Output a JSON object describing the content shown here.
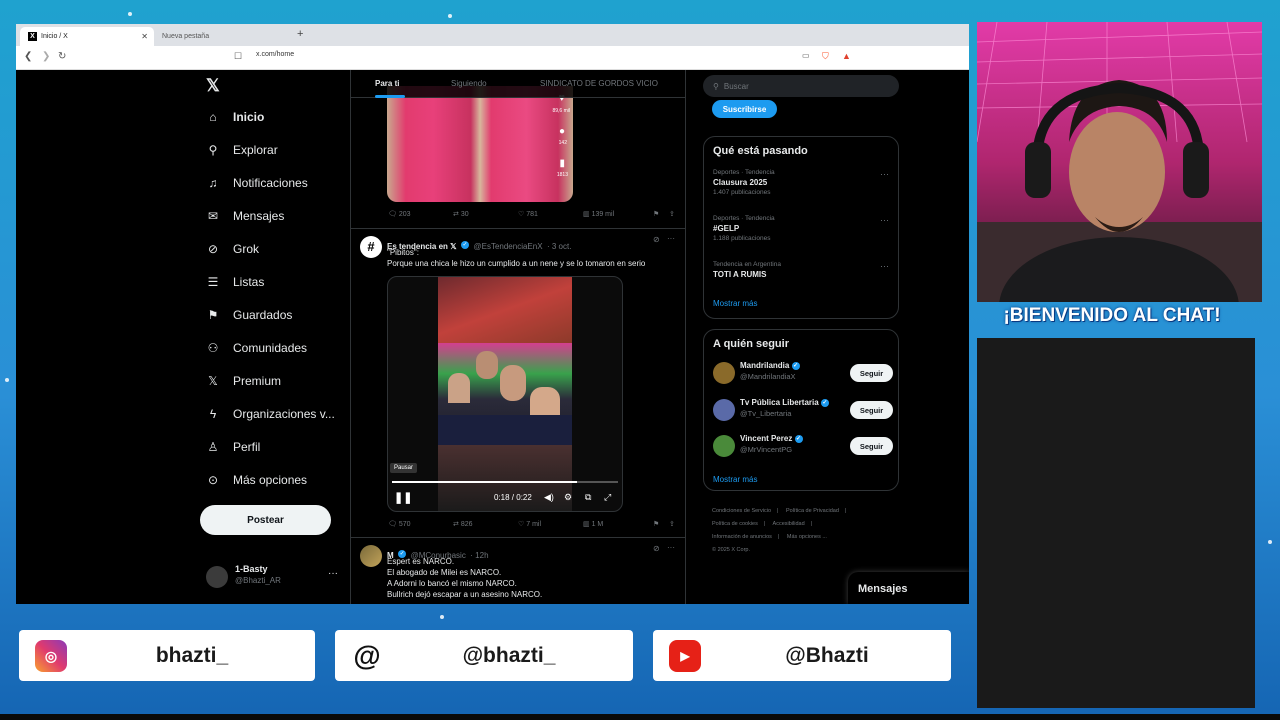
{
  "browser": {
    "tabs": [
      {
        "label": "Inicio / X"
      },
      {
        "label": "Nueva pestaña"
      }
    ],
    "url": "x.com/home"
  },
  "nav": {
    "items": [
      {
        "label": "Inicio",
        "icon": "home-icon"
      },
      {
        "label": "Explorar",
        "icon": "search-icon"
      },
      {
        "label": "Notificaciones",
        "icon": "bell-icon"
      },
      {
        "label": "Mensajes",
        "icon": "mail-icon"
      },
      {
        "label": "Grok",
        "icon": "grok-icon"
      },
      {
        "label": "Listas",
        "icon": "list-icon"
      },
      {
        "label": "Guardados",
        "icon": "bookmark-icon"
      },
      {
        "label": "Comunidades",
        "icon": "people-icon"
      },
      {
        "label": "Premium",
        "icon": "x-icon"
      },
      {
        "label": "Organizaciones v...",
        "icon": "lightning-icon"
      },
      {
        "label": "Perfil",
        "icon": "person-icon"
      },
      {
        "label": "Más opciones",
        "icon": "more-circle-icon"
      }
    ],
    "post_label": "Postear",
    "profile": {
      "name": "1-Basty",
      "handle": "@Bhazti_AR"
    }
  },
  "feed": {
    "tabs": [
      "Para ti",
      "Siguiendo",
      "SINDICATO DE GORDOS VICIO"
    ],
    "post1": {
      "overlay_counts": [
        "89,6 mil",
        "142",
        "1813"
      ],
      "actions": {
        "replies": "203",
        "reposts": "30",
        "likes": "781",
        "views": "139 mil"
      }
    },
    "post2": {
      "name": "Es tendencia en 𝕏",
      "handle": "@EsTendenciaEnX",
      "time": "· 3 oct.",
      "text_line1": "\"Pibitos\":",
      "text_line2": "Porque una chica le hizo un cumplido a un nene y se lo tomaron en serio",
      "video": {
        "tooltip": "Pausar",
        "time": "0:18 / 0:22",
        "progress": 0.82
      },
      "actions": {
        "replies": "570",
        "reposts": "826",
        "likes": "7 mil",
        "views": "1 M"
      }
    },
    "post3": {
      "name": "M",
      "handle": "@MConurbasic",
      "time": "· 12h",
      "lines": [
        "Espert es NARCO.",
        "El abogado de Milei es NARCO.",
        "A Adorni lo bancó el mismo NARCO.",
        "Bullrich dejó escapar a un asesino NARCO."
      ]
    }
  },
  "right": {
    "search_placeholder": "Buscar",
    "subscribe_label": "Suscribirse",
    "trending": {
      "title": "Qué está pasando",
      "items": [
        {
          "category": "Deportes · Tendencia",
          "name": "Clausura 2025",
          "count": "1.407 publicaciones"
        },
        {
          "category": "Deportes · Tendencia",
          "name": "#GELP",
          "count": "1.188 publicaciones"
        },
        {
          "category": "Tendencia en Argentina",
          "name": "TOTI A RUMIS",
          "count": ""
        }
      ],
      "show_more": "Mostrar más"
    },
    "who_to_follow": {
      "title": "A quién seguir",
      "items": [
        {
          "name": "Mandrilandia",
          "handle": "@MandrilandiaX",
          "button": "Seguir"
        },
        {
          "name": "Tv Pública Libertaria",
          "handle": "@Tv_Libertaria",
          "button": "Seguir"
        },
        {
          "name": "Vincent Perez",
          "handle": "@MrVincentPG",
          "button": "Seguir"
        }
      ],
      "show_more": "Mostrar más"
    },
    "footer": {
      "links": [
        "Condiciones de Servicio",
        "Política de Privacidad",
        "Política de cookies",
        "Accesibilidad",
        "Información de anuncios",
        "Más opciones ..."
      ],
      "copyright": "© 2025 X Corp."
    },
    "messages_label": "Mensajes"
  },
  "overlay": {
    "welcome": "¡BIENVENIDO AL CHAT!",
    "socials": [
      {
        "platform": "instagram",
        "handle": "bhazti_"
      },
      {
        "platform": "threads",
        "handle": "@bhazti_"
      },
      {
        "platform": "youtube",
        "handle": "@Bhazti"
      }
    ]
  },
  "colors": {
    "accent": "#1d9bf0",
    "background": "#000000",
    "stream_bg": "#1fa2cf"
  }
}
